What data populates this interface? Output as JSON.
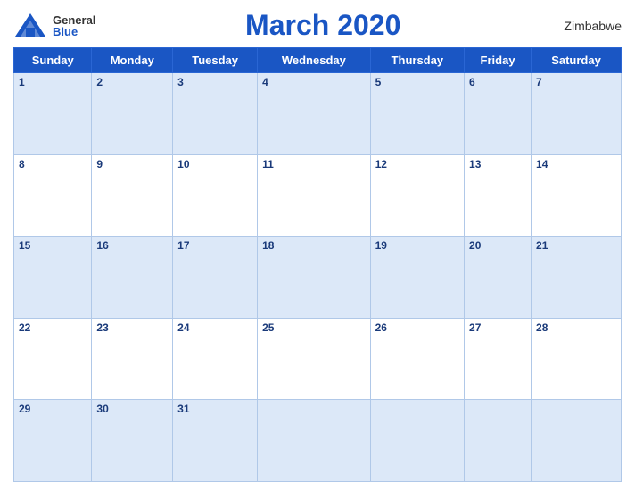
{
  "header": {
    "logo": {
      "general": "General",
      "blue": "Blue"
    },
    "title": "March 2020",
    "country": "Zimbabwe"
  },
  "weekdays": [
    "Sunday",
    "Monday",
    "Tuesday",
    "Wednesday",
    "Thursday",
    "Friday",
    "Saturday"
  ],
  "weeks": [
    [
      {
        "day": "1",
        "empty": false
      },
      {
        "day": "2",
        "empty": false
      },
      {
        "day": "3",
        "empty": false
      },
      {
        "day": "4",
        "empty": false
      },
      {
        "day": "5",
        "empty": false
      },
      {
        "day": "6",
        "empty": false
      },
      {
        "day": "7",
        "empty": false
      }
    ],
    [
      {
        "day": "8",
        "empty": false
      },
      {
        "day": "9",
        "empty": false
      },
      {
        "day": "10",
        "empty": false
      },
      {
        "day": "11",
        "empty": false
      },
      {
        "day": "12",
        "empty": false
      },
      {
        "day": "13",
        "empty": false
      },
      {
        "day": "14",
        "empty": false
      }
    ],
    [
      {
        "day": "15",
        "empty": false
      },
      {
        "day": "16",
        "empty": false
      },
      {
        "day": "17",
        "empty": false
      },
      {
        "day": "18",
        "empty": false
      },
      {
        "day": "19",
        "empty": false
      },
      {
        "day": "20",
        "empty": false
      },
      {
        "day": "21",
        "empty": false
      }
    ],
    [
      {
        "day": "22",
        "empty": false
      },
      {
        "day": "23",
        "empty": false
      },
      {
        "day": "24",
        "empty": false
      },
      {
        "day": "25",
        "empty": false
      },
      {
        "day": "26",
        "empty": false
      },
      {
        "day": "27",
        "empty": false
      },
      {
        "day": "28",
        "empty": false
      }
    ],
    [
      {
        "day": "29",
        "empty": false
      },
      {
        "day": "30",
        "empty": false
      },
      {
        "day": "31",
        "empty": false
      },
      {
        "day": "",
        "empty": true
      },
      {
        "day": "",
        "empty": true
      },
      {
        "day": "",
        "empty": true
      },
      {
        "day": "",
        "empty": true
      }
    ]
  ]
}
